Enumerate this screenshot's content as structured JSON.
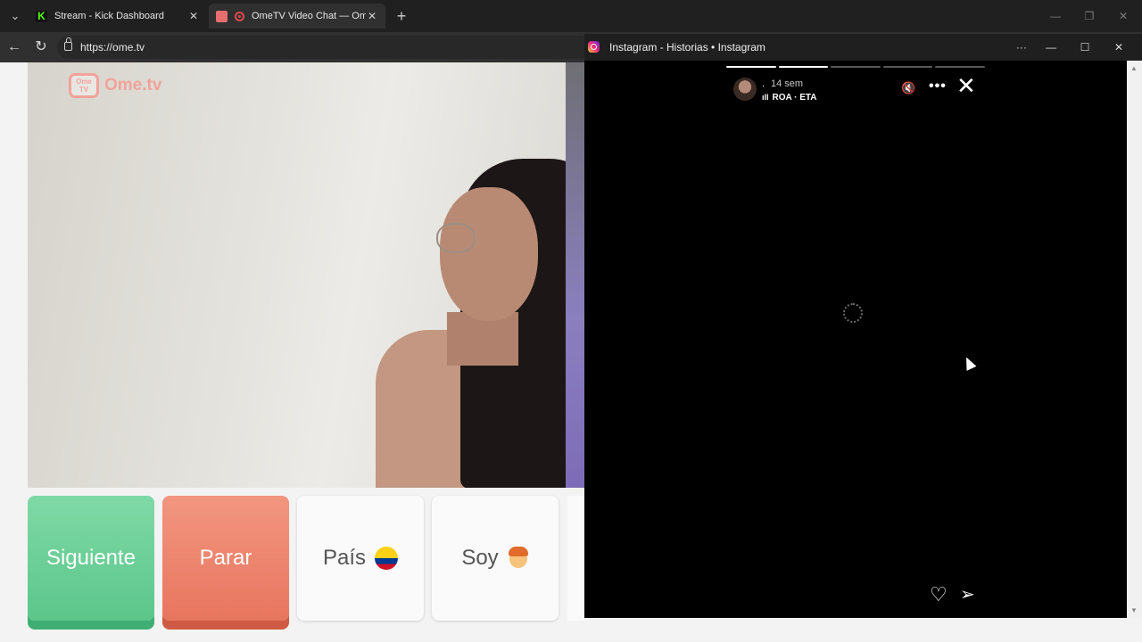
{
  "browser": {
    "tabs": [
      {
        "title": "Stream - Kick Dashboard",
        "favicon": "kick-icon"
      },
      {
        "title": "OmeTV Video Chat — Omegl",
        "favicon": "ometv-icon",
        "recording": true
      }
    ],
    "active_tab_index": 1,
    "url": "https://ome.tv"
  },
  "ometv": {
    "logo_small": "Ome TV",
    "logo_text": "Ome.tv",
    "buttons": {
      "next": "Siguiente",
      "stop": "Parar",
      "country": "País",
      "gender": "Soy"
    },
    "chat_placeholder": "",
    "accent_green": "#5bc68a",
    "accent_red": "#e8755e"
  },
  "instagram": {
    "window_title": "Instagram - Historias • Instagram",
    "story": {
      "username": ".",
      "time_ago": "14 sem",
      "music": "ROA · ETA",
      "segments_total": 5,
      "segments_done": 2
    }
  }
}
